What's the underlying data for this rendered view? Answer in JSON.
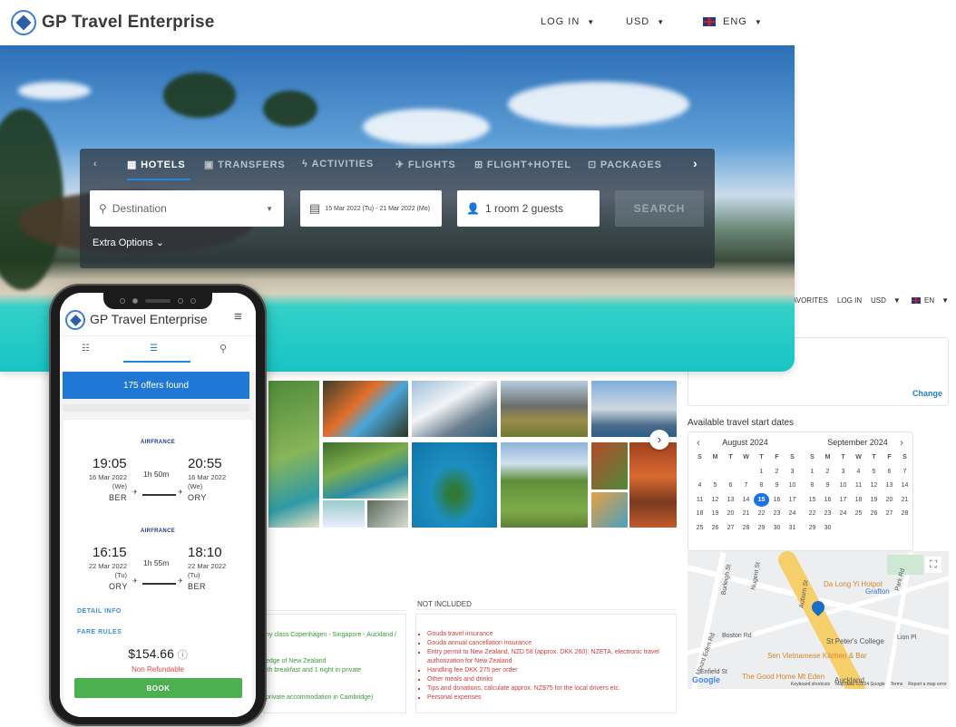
{
  "header": {
    "brand": "GP Travel Enterprise",
    "login": "LOG IN",
    "currency": "USD",
    "language": "ENG"
  },
  "search": {
    "tabs": [
      "HOTELS",
      "TRANSFERS",
      "ACTIVITIES",
      "FLIGHTS",
      "FLIGHT+HOTEL",
      "PACKAGES"
    ],
    "active_tab": "HOTELS",
    "destination_placeholder": "Destination",
    "dates": "15 Mar 2022 (Tu) -  21 Mar 2022 (Mo)",
    "guests": "1 room 2 guests",
    "search_label": "SEARCH",
    "extra_options": "Extra Options"
  },
  "detail_page": {
    "nav": {
      "favorites": "AVORITES",
      "login": "LOG IN",
      "currency": "USD",
      "language": "EN"
    },
    "change_label": "Change",
    "available_dates_title": "Available travel start dates",
    "calendar": {
      "weekdays": [
        "S",
        "M",
        "T",
        "W",
        "T",
        "F",
        "S"
      ],
      "selected_day": 15,
      "months": [
        {
          "title": "August 2024",
          "days": [
            "",
            "",
            "",
            "",
            "1",
            "2",
            "3",
            "4",
            "5",
            "6",
            "7",
            "8",
            "9",
            "10",
            "11",
            "12",
            "13",
            "14",
            "15",
            "16",
            "17",
            "18",
            "19",
            "20",
            "21",
            "22",
            "23",
            "24",
            "25",
            "26",
            "27",
            "28",
            "29",
            "30",
            "31"
          ]
        },
        {
          "title": "September 2024",
          "days": [
            "1",
            "2",
            "3",
            "4",
            "5",
            "6",
            "7",
            "8",
            "9",
            "10",
            "11",
            "12",
            "13",
            "14",
            "15",
            "16",
            "17",
            "18",
            "19",
            "20",
            "21",
            "22",
            "23",
            "24",
            "25",
            "26",
            "27",
            "28",
            "29",
            "30"
          ]
        }
      ]
    },
    "map": {
      "places": [
        "Da Long Yi Hotpot",
        "Grafton",
        "St Peter's College",
        "Sen Vietnamese Kitchen & Bar",
        "The Good Home Mt Eden",
        "Auckland"
      ],
      "streets": [
        "Mount Eden Rd",
        "Boston Rd",
        "Enfield St",
        "Park Rd",
        "Lion Pl",
        "Burleigh St",
        "Nugent St",
        "Auburn St"
      ],
      "footer": [
        "Keyboard shortcuts",
        "Map data ©2024 Google",
        "Terms",
        "Report a map error"
      ],
      "logo": "Google"
    },
    "included": [
      "ny class Copenhagen - Singapore - Auckland /",
      "edge of New Zealand",
      "ith breakfast and 1 night in private",
      "private accommodation in Cambridge)"
    ],
    "not_included_title": "NOT INCLUDED",
    "not_included": [
      "Gouda travel insurance",
      "Gouda annual cancellation insurance",
      "Entry permit to New Zealand, NZD 58 (approx. DKK 260): NZETA, electronic travel authorization for New Zealand",
      "Handling fee DKK 275 per order",
      "Other meals and drinks",
      "Tips and donations, calculate approx. NZ$75 for the local drivers etc.",
      "Personal expenses"
    ]
  },
  "mobile": {
    "brand": "GP Travel Enterprise",
    "offers": "175 offers found",
    "flights": [
      {
        "airline": "AIRFRANCE",
        "dep_time": "19:05",
        "dep_date": "16 Mar 2022",
        "dep_day": "(We)",
        "dep_airport": "BER",
        "duration": "1h 50m",
        "arr_time": "20:55",
        "arr_date": "16 Mar 2022",
        "arr_day": "(We)",
        "arr_airport": "ORY"
      },
      {
        "airline": "AIRFRANCE",
        "dep_time": "16:15",
        "dep_date": "22 Mar 2022",
        "dep_day": "(Tu)",
        "dep_airport": "ORY",
        "duration": "1h 55m",
        "arr_time": "18:10",
        "arr_date": "22 Mar 2022",
        "arr_day": "(Tu)",
        "arr_airport": "BER"
      }
    ],
    "detail_info": "DETAIL INFO",
    "fare_rules": "FARE RULES",
    "price": "$154.66",
    "refund": "Non Refundable",
    "book": "BOOK"
  },
  "colors": {
    "primary": "#1a73e8",
    "offers_bar": "#1e78d4",
    "book": "#4caf50",
    "non_refundable": "#e04848",
    "included": "#3a9a3a",
    "not_included": "#d73a3a"
  }
}
